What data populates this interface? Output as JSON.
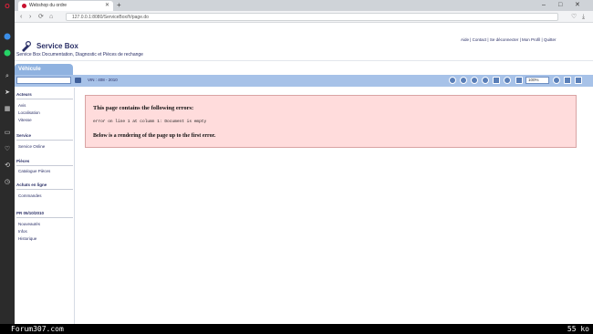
{
  "browser": {
    "tab_title": "Webshop du ordre",
    "url": "127.0.0.1:8080/ServiceBox/fr/page.do",
    "new_tab": "+",
    "minimize": "–",
    "maximize": "□",
    "close": "✕",
    "back": "‹",
    "forward": "›",
    "reload": "⟳",
    "home": "⌂"
  },
  "sidebar_icons": [
    "opera-logo-icon",
    "messenger-icon",
    "whatsapp-icon",
    "search-icon",
    "send-icon",
    "grid-icon",
    "news-icon",
    "heart-icon",
    "history-icon",
    "clock-icon"
  ],
  "header": {
    "title": "Service Box",
    "subtitle": "Service Box Documentation, Diagnostic et Pièces de rechange",
    "top_links": "Aide | Contact | Se déconnecter | Mon Profil | Quitter"
  },
  "vehicle": {
    "tab_label": "Véhicule",
    "model_info": "VIN : 408 - 2010"
  },
  "toolbar": {
    "zoom_value": "100%"
  },
  "nav": {
    "section1_title": "Acteurs",
    "section1_items": [
      "Avis",
      "Localisation",
      "Vitesse"
    ],
    "section2_title": "Service",
    "section2_items": [
      "Service Online"
    ],
    "section3_title": "Pièces",
    "section3_items": [
      "Catalogue Pièces"
    ],
    "section4_title": "Achats en ligne",
    "section4_items": [
      "Commandes"
    ],
    "section5_title": "PR 05/10/2010",
    "section5_items": [
      "Nouveautés",
      "Infos",
      "Historique"
    ]
  },
  "error": {
    "title": "This page contains the following errors:",
    "detail": "error on line 1 at column 1: Document is empty",
    "footer": "Below is a rendering of the page up to the first error."
  },
  "footer": {
    "forum": "Forum307.com",
    "size": "55 ko"
  },
  "colors": {
    "band": "#a7c2e8",
    "error_bg": "#ffdcdc",
    "brand_text": "#2a2f66"
  }
}
